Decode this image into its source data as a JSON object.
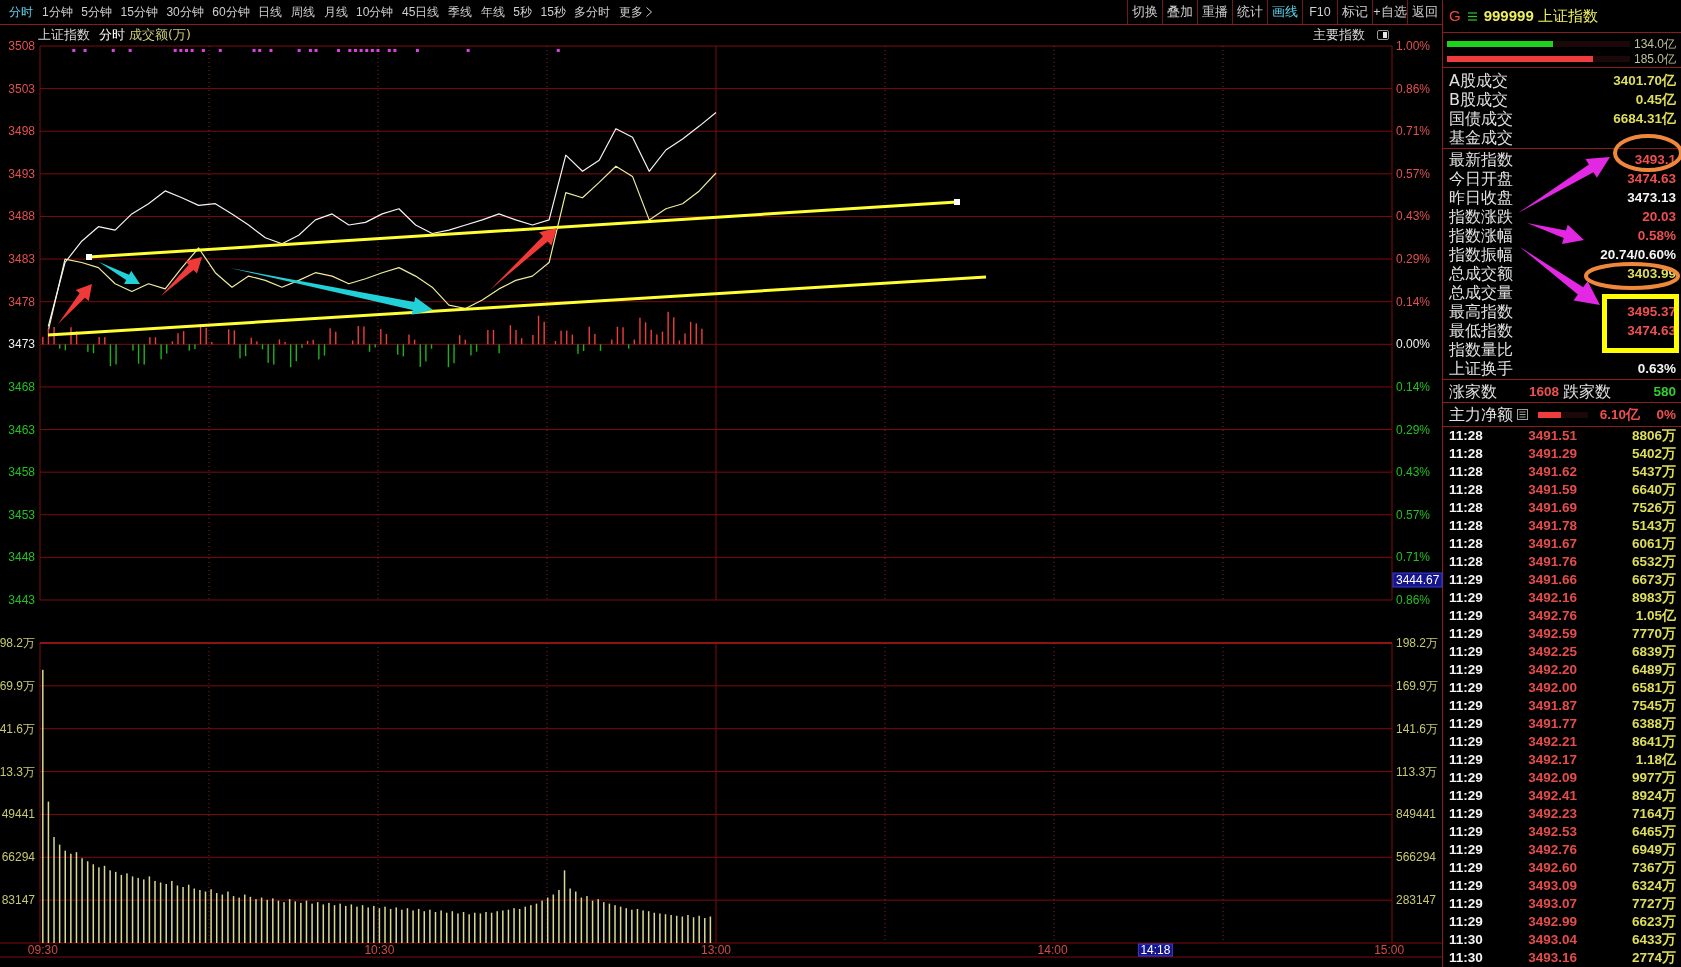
{
  "toolbar": {
    "periods": [
      {
        "label": "分时",
        "selected": true,
        "kind": "period"
      },
      {
        "label": "1分钟",
        "selected": false,
        "kind": "period"
      },
      {
        "label": "5分钟",
        "selected": false,
        "kind": "period"
      },
      {
        "label": "15分钟",
        "selected": false,
        "kind": "period"
      },
      {
        "label": "30分钟",
        "selected": false,
        "kind": "period"
      },
      {
        "label": "60分钟",
        "selected": false,
        "kind": "period"
      },
      {
        "label": "日线",
        "selected": false,
        "kind": "period"
      },
      {
        "label": "周线",
        "selected": false,
        "kind": "period"
      },
      {
        "label": "月线",
        "selected": false,
        "kind": "period"
      },
      {
        "label": "10分钟",
        "selected": false,
        "kind": "period"
      },
      {
        "label": "45日线",
        "selected": false,
        "kind": "period"
      },
      {
        "label": "季线",
        "selected": false,
        "kind": "period"
      },
      {
        "label": "年线",
        "selected": false,
        "kind": "period"
      },
      {
        "label": "5秒",
        "selected": false,
        "kind": "period"
      },
      {
        "label": "15秒",
        "selected": false,
        "kind": "period"
      },
      {
        "label": "多分时",
        "selected": false,
        "kind": "period"
      },
      {
        "label": "更多",
        "selected": false,
        "kind": "menu"
      }
    ],
    "tools": [
      {
        "label": "切换",
        "selected": false
      },
      {
        "label": "叠加",
        "selected": false
      },
      {
        "label": "重播",
        "selected": false
      },
      {
        "label": "统计",
        "selected": false
      },
      {
        "label": "画线",
        "selected": true
      },
      {
        "label": "F10",
        "selected": false
      },
      {
        "label": "标记",
        "selected": false
      },
      {
        "label": "+自选",
        "selected": false
      },
      {
        "label": "返回",
        "selected": false
      }
    ]
  },
  "chart_header": {
    "title": "上证指数",
    "mode": "分时",
    "indicator": "成交额(万)",
    "selector": "主要指数"
  },
  "price_chart": {
    "chart_data": {
      "type": "line",
      "grid": true,
      "ylim": [
        3443,
        3508
      ],
      "categories": [
        null,
        null,
        null,
        null,
        null,
        null,
        null,
        null,
        null,
        null,
        null,
        null,
        null,
        null,
        null,
        null,
        null,
        null,
        null,
        null,
        null,
        null,
        null,
        null,
        null,
        null,
        null,
        null,
        null,
        null,
        null,
        null,
        null,
        null,
        null,
        null,
        null,
        null,
        null,
        null,
        null,
        null,
        null,
        null,
        null,
        null,
        null,
        null,
        null,
        null,
        null,
        null,
        null,
        null,
        null,
        null,
        null,
        null,
        null,
        null,
        null,
        null,
        null,
        null,
        null,
        null,
        null,
        null,
        null,
        null,
        null,
        null,
        null,
        null,
        null,
        null,
        null,
        null,
        null,
        null,
        null
      ],
      "series": [
        {
          "color": "#ecec9c",
          "values": [
            3474.6,
            3483.0,
            3482.6,
            3482.0,
            3480.1,
            3479.2,
            3480.1,
            3479.5,
            3482.0,
            3484.3,
            3481.4,
            3479.7,
            3481.0,
            3480.5,
            3479.7,
            3480.5,
            3481.4,
            3481.0,
            3480.1,
            3480.7,
            3481.4,
            3482.0,
            3481.0,
            3479.7,
            3477.6,
            3477.2,
            3478.2,
            3479.5,
            3480.5,
            3481.0,
            3482.6,
            3490.8,
            3490.2,
            3492.0,
            3493.9,
            3492.7,
            3487.6,
            3488.9,
            3489.5,
            3491.0,
            3493.1,
            null,
            null,
            null,
            null,
            null,
            null,
            null,
            null,
            null,
            null,
            null,
            null,
            null,
            null,
            null,
            null,
            null,
            null,
            null,
            null,
            null,
            null,
            null,
            null,
            null,
            null,
            null,
            null,
            null,
            null,
            null,
            null,
            null,
            null,
            null,
            null,
            null,
            null,
            null,
            null
          ]
        },
        {
          "color": "#f4f4f4",
          "values": [
            3475.1,
            3482.6,
            3485.1,
            3486.8,
            3486.4,
            3488.3,
            3489.5,
            3491.0,
            3490.2,
            3489.3,
            3489.5,
            3488.3,
            3487.0,
            3485.5,
            3484.8,
            3485.8,
            3487.6,
            3488.3,
            3487.0,
            3487.3,
            3488.3,
            3488.9,
            3487.0,
            3486.0,
            3486.4,
            3487.0,
            3487.6,
            3488.3,
            3487.6,
            3487.0,
            3487.6,
            3495.2,
            3493.3,
            3494.6,
            3498.3,
            3497.3,
            3493.3,
            3495.8,
            3497.1,
            3498.6,
            3500.2,
            null,
            null,
            null,
            null,
            null,
            null,
            null,
            null,
            null,
            null,
            null,
            null,
            null,
            null,
            null,
            null,
            null,
            null,
            null,
            null,
            null,
            null,
            null,
            null,
            null,
            null,
            null,
            null,
            null,
            null,
            null,
            null,
            null,
            null,
            null,
            null,
            null,
            null,
            null,
            null
          ]
        }
      ],
      "yticks": [
        {
          "value": 3508,
          "label": "3508"
        },
        {
          "value": 3503,
          "label": "3503"
        },
        {
          "value": 3498,
          "label": "3498"
        },
        {
          "value": 3493,
          "label": "3493"
        },
        {
          "value": 3488,
          "label": "3488"
        },
        {
          "value": 3483,
          "label": "3483"
        },
        {
          "value": 3478,
          "label": "3478"
        },
        {
          "value": 3473,
          "label": "3473"
        },
        {
          "value": 3468,
          "label": "3468"
        },
        {
          "value": 3463,
          "label": "3463"
        },
        {
          "value": 3458,
          "label": "3458"
        },
        {
          "value": 3453,
          "label": "3453"
        },
        {
          "value": 3448,
          "label": "3448"
        },
        {
          "value": 3443,
          "label": "3443"
        }
      ]
    },
    "percent_labels": [
      {
        "text": "1.00%",
        "kind": "up"
      },
      {
        "text": "0.86%",
        "kind": "up"
      },
      {
        "text": "0.71%",
        "kind": "up"
      },
      {
        "text": "0.57%",
        "kind": "up"
      },
      {
        "text": "0.43%",
        "kind": "up"
      },
      {
        "text": "0.29%",
        "kind": "up"
      },
      {
        "text": "0.14%",
        "kind": "up"
      },
      {
        "text": "0.00%",
        "kind": "flat"
      },
      {
        "text": "0.14%",
        "kind": "down"
      },
      {
        "text": "0.29%",
        "kind": "down"
      },
      {
        "text": "0.43%",
        "kind": "down"
      },
      {
        "text": "0.57%",
        "kind": "down"
      },
      {
        "text": "0.71%",
        "kind": "down"
      },
      {
        "text": "0.86%",
        "kind": "down"
      }
    ],
    "cursor_label": "3444.67"
  },
  "volume_chart": {
    "chart_data": {
      "type": "bar",
      "grid": true,
      "ylim": [
        0,
        1982029
      ],
      "categories": [
        "09:30",
        null,
        null,
        null,
        null,
        null,
        null,
        null,
        null,
        null,
        null,
        null,
        null,
        null,
        null,
        null,
        null,
        null,
        null,
        null,
        null,
        null,
        null,
        null,
        null,
        null,
        null,
        null,
        null,
        null,
        null,
        null,
        null,
        null,
        null,
        null,
        null,
        null,
        null,
        null,
        null,
        null,
        null,
        null,
        null,
        null,
        null,
        null,
        null,
        null,
        null,
        null,
        null,
        null,
        null,
        null,
        null,
        null,
        null,
        null,
        "10:30",
        null,
        null,
        null,
        null,
        null,
        null,
        null,
        null,
        null,
        null,
        null,
        null,
        null,
        null,
        null,
        null,
        null,
        null,
        null,
        null,
        null,
        null,
        null,
        null,
        null,
        null,
        null,
        null,
        null,
        null,
        null,
        null,
        null,
        null,
        null,
        null,
        null,
        null,
        null,
        null,
        null,
        null,
        null,
        null,
        null,
        null,
        null,
        null,
        null,
        null,
        null,
        null,
        null,
        null,
        null,
        null,
        null,
        null,
        null,
        "13:00",
        null,
        null,
        null,
        null,
        null,
        null,
        null,
        null,
        null,
        null,
        null,
        null,
        null,
        null,
        null,
        null,
        null,
        null,
        null,
        null,
        null,
        null,
        null,
        null,
        null,
        null,
        null,
        null,
        null,
        null,
        null,
        null,
        null,
        null,
        null,
        null,
        null,
        null,
        null,
        null,
        null,
        null,
        null,
        null,
        null,
        null,
        null,
        null,
        null,
        null,
        null,
        null,
        null,
        null,
        null,
        null,
        null,
        null,
        null,
        "14:00",
        null,
        null,
        null,
        null,
        null,
        null,
        null,
        null,
        null,
        null,
        null,
        null,
        null,
        null,
        null,
        null,
        null,
        null,
        null,
        null,
        null,
        null,
        null,
        null,
        null,
        null,
        null,
        null,
        null,
        null,
        null,
        null,
        null,
        null,
        null,
        null,
        null,
        null,
        null,
        null,
        null,
        null,
        null,
        null,
        null,
        null,
        null,
        null,
        null,
        null,
        null,
        null,
        null,
        null,
        null,
        null,
        null,
        null,
        null,
        "15:00"
      ],
      "series": [
        {
          "color": "#d8d890",
          "values": [
            1805000,
            934000,
            700000,
            650000,
            610000,
            590000,
            600000,
            560000,
            540000,
            520000,
            500000,
            510000,
            480000,
            470000,
            450000,
            460000,
            440000,
            430000,
            420000,
            440000,
            410000,
            400000,
            390000,
            410000,
            380000,
            370000,
            385000,
            360000,
            350000,
            340000,
            355000,
            330000,
            320000,
            340000,
            310000,
            300000,
            320000,
            305000,
            290000,
            300000,
            285000,
            295000,
            280000,
            270000,
            290000,
            275000,
            265000,
            280000,
            260000,
            270000,
            255000,
            265000,
            250000,
            260000,
            245000,
            255000,
            240000,
            250000,
            235000,
            245000,
            230000,
            240000,
            225000,
            235000,
            220000,
            230000,
            215000,
            225000,
            210000,
            220000,
            205000,
            215000,
            200000,
            210000,
            195000,
            205000,
            190000,
            200000,
            195000,
            205000,
            200000,
            210000,
            215000,
            220000,
            230000,
            225000,
            240000,
            250000,
            260000,
            280000,
            300000,
            320000,
            350000,
            480000,
            360000,
            340000,
            300000,
            310000,
            280000,
            290000,
            270000,
            260000,
            250000,
            240000,
            230000,
            220000,
            225000,
            215000,
            210000,
            200000,
            195000,
            190000,
            185000,
            180000,
            175000,
            185000,
            170000,
            180000,
            165000,
            175000,
            null,
            null,
            null,
            null,
            null,
            null,
            null,
            null,
            null,
            null,
            null,
            null,
            null,
            null,
            null,
            null,
            null,
            null,
            null,
            null,
            null,
            null,
            null,
            null,
            null,
            null,
            null,
            null,
            null,
            null,
            null,
            null,
            null,
            null,
            null,
            null,
            null,
            null,
            null,
            null,
            null,
            null,
            null,
            null,
            null,
            null,
            null,
            null,
            null,
            null,
            null,
            null,
            null,
            null,
            null,
            null,
            null,
            null,
            null,
            null,
            null,
            null,
            null,
            null,
            null,
            null,
            null,
            null,
            null,
            null,
            null,
            null,
            null,
            null,
            null,
            null,
            null,
            null,
            null,
            null,
            null,
            null,
            null,
            null,
            null,
            null,
            null,
            null,
            null,
            null,
            null,
            null,
            null,
            null,
            null,
            null,
            null,
            null,
            null,
            null,
            null,
            null,
            null,
            null,
            null,
            null,
            null,
            null,
            null,
            null,
            null,
            null,
            null,
            null,
            null,
            null,
            null,
            null,
            null,
            null,
            null
          ]
        }
      ],
      "yticks": [
        {
          "value": 849441,
          "label": "849441"
        },
        {
          "value": 566294,
          "label": "566294"
        },
        {
          "value": 283147,
          "label": "283147"
        }
      ]
    },
    "upper_tick_labels": [
      "198.2万",
      "169.9万",
      "141.6万",
      "113.3万"
    ],
    "left_labels": [
      "98.2万",
      "69.9万",
      "41.6万",
      "13.3万",
      "49441",
      "66294",
      "83147"
    ],
    "cursor_label": "14:18"
  },
  "quote_panel": {
    "header": {
      "market": "G",
      "code": "999999",
      "name": "上证指数"
    },
    "meters": [
      {
        "kind": "buy",
        "level": 0.58,
        "reading": "134.0亿"
      },
      {
        "kind": "sell",
        "level": 0.8,
        "reading": "185.0亿"
      }
    ],
    "turnover": [
      {
        "label": "A股成交",
        "value": "3401.70亿"
      },
      {
        "label": "B股成交",
        "value": "0.45亿"
      },
      {
        "label": "国债成交",
        "value": "6684.31亿"
      },
      {
        "label": "基金成交"
      }
    ],
    "index_stats": [
      {
        "label": "最新指数",
        "value": "3493.1",
        "kind": "up"
      },
      {
        "label": "今日开盘",
        "value": "3474.63",
        "kind": "up"
      },
      {
        "label": "昨日收盘",
        "value": "3473.13",
        "kind": "flat"
      },
      {
        "label": "指数涨跌",
        "value": "20.03",
        "kind": "up"
      },
      {
        "label": "指数涨幅",
        "value": "0.58%",
        "kind": "up"
      },
      {
        "label": "指数振幅",
        "value": "20.74/0.60%",
        "kind": "flat"
      },
      {
        "label": "总成交额",
        "value": "3403.99",
        "kind": "amount"
      },
      {
        "label": "总成交量"
      },
      {
        "label": "最高指数",
        "value": "3495.37",
        "kind": "up"
      },
      {
        "label": "最低指数",
        "value": "3474.63",
        "kind": "up"
      },
      {
        "label": "指数量比"
      },
      {
        "label": "上证换手",
        "value": "0.63%",
        "kind": "flat"
      }
    ],
    "breadth": {
      "up_label": "涨家数",
      "up_count": "1608",
      "down_label": "跌家数",
      "down_count": "580"
    },
    "main_flow": {
      "label": "主力净额",
      "level": 0.45,
      "amount": "6.10亿",
      "ratio": "0%"
    },
    "ticks": [
      {
        "time": "11:28",
        "price": "3491.51",
        "volume": "8806万"
      },
      {
        "time": "11:28",
        "price": "3491.29",
        "volume": "5402万"
      },
      {
        "time": "11:28",
        "price": "3491.62",
        "volume": "5437万"
      },
      {
        "time": "11:28",
        "price": "3491.59",
        "volume": "6640万"
      },
      {
        "time": "11:28",
        "price": "3491.69",
        "volume": "7526万"
      },
      {
        "time": "11:28",
        "price": "3491.78",
        "volume": "5143万"
      },
      {
        "time": "11:28",
        "price": "3491.67",
        "volume": "6061万"
      },
      {
        "time": "11:28",
        "price": "3491.76",
        "volume": "6532万"
      },
      {
        "time": "11:29",
        "price": "3491.66",
        "volume": "6673万"
      },
      {
        "time": "11:29",
        "price": "3492.16",
        "volume": "8983万"
      },
      {
        "time": "11:29",
        "price": "3492.76",
        "volume": "1.05亿"
      },
      {
        "time": "11:29",
        "price": "3492.59",
        "volume": "7770万"
      },
      {
        "time": "11:29",
        "price": "3492.25",
        "volume": "6839万"
      },
      {
        "time": "11:29",
        "price": "3492.20",
        "volume": "6489万"
      },
      {
        "time": "11:29",
        "price": "3492.00",
        "volume": "6581万"
      },
      {
        "time": "11:29",
        "price": "3491.87",
        "volume": "7545万"
      },
      {
        "time": "11:29",
        "price": "3491.77",
        "volume": "6388万"
      },
      {
        "time": "11:29",
        "price": "3492.21",
        "volume": "8641万"
      },
      {
        "time": "11:29",
        "price": "3492.17",
        "volume": "1.18亿"
      },
      {
        "time": "11:29",
        "price": "3492.09",
        "volume": "9977万"
      },
      {
        "time": "11:29",
        "price": "3492.41",
        "volume": "8924万"
      },
      {
        "time": "11:29",
        "price": "3492.23",
        "volume": "7164万"
      },
      {
        "time": "11:29",
        "price": "3492.53",
        "volume": "6465万"
      },
      {
        "time": "11:29",
        "price": "3492.76",
        "volume": "6949万"
      },
      {
        "time": "11:29",
        "price": "3492.60",
        "volume": "7367万"
      },
      {
        "time": "11:29",
        "price": "3493.09",
        "volume": "6324万"
      },
      {
        "time": "11:29",
        "price": "3493.07",
        "volume": "7727万"
      },
      {
        "time": "11:29",
        "price": "3492.99",
        "volume": "6623万"
      },
      {
        "time": "11:30",
        "price": "3493.04",
        "volume": "6433万"
      },
      {
        "time": "11:30",
        "price": "3493.16",
        "volume": "2774万"
      }
    ]
  },
  "markup": [
    {
      "kind": "trend_line",
      "color": "#ffff33"
    },
    {
      "kind": "trend_line",
      "color": "#ffff33"
    },
    {
      "kind": "arrow",
      "color": "#f03a3a"
    },
    {
      "kind": "arrow",
      "color": "#f03a3a"
    },
    {
      "kind": "arrow",
      "color": "#f03a3a"
    },
    {
      "kind": "arrow",
      "color": "#22d0d8"
    },
    {
      "kind": "arrow",
      "color": "#22d0d8"
    },
    {
      "kind": "arrow",
      "color": "#e228e2"
    },
    {
      "kind": "arrow",
      "color": "#e228e2"
    },
    {
      "kind": "arrow",
      "color": "#e228e2"
    },
    {
      "kind": "ellipse",
      "color": "#f0883c"
    },
    {
      "kind": "ellipse",
      "color": "#f0883c"
    },
    {
      "kind": "frame",
      "color": "#ffff00"
    }
  ]
}
